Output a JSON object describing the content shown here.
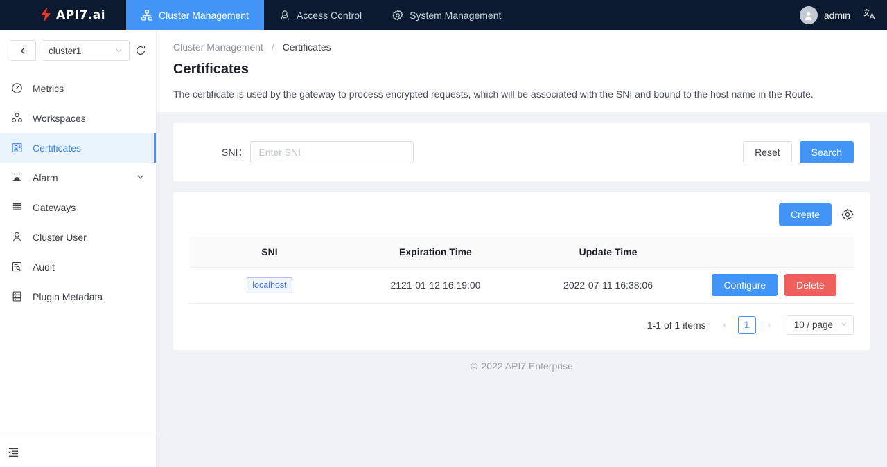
{
  "topnav": {
    "logo_text": "API7.ai",
    "items": [
      {
        "label": "Cluster Management",
        "icon": "cluster-icon",
        "active": true
      },
      {
        "label": "Access Control",
        "icon": "access-control-icon",
        "active": false
      },
      {
        "label": "System Management",
        "icon": "gear-icon",
        "active": false
      }
    ],
    "user": "admin",
    "lang_icon": "文"
  },
  "sidebar": {
    "cluster_value": "cluster1",
    "items": [
      {
        "label": "Metrics",
        "icon": "metrics-icon"
      },
      {
        "label": "Workspaces",
        "icon": "workspaces-icon"
      },
      {
        "label": "Certificates",
        "icon": "certificate-icon"
      },
      {
        "label": "Alarm",
        "icon": "alarm-icon"
      },
      {
        "label": "Gateways",
        "icon": "gateways-icon"
      },
      {
        "label": "Cluster User",
        "icon": "user-icon"
      },
      {
        "label": "Audit",
        "icon": "audit-icon"
      },
      {
        "label": "Plugin Metadata",
        "icon": "plugin-metadata-icon"
      }
    ]
  },
  "breadcrumb": {
    "parent": "Cluster Management",
    "separator": "/",
    "current": "Certificates"
  },
  "page": {
    "title": "Certificates",
    "description": "The certificate is used by the gateway to process encrypted requests, which will be associated with the SNI and bound to the host name in the Route."
  },
  "filter": {
    "label": "SNI：",
    "placeholder": "Enter SNI",
    "value": "",
    "reset_label": "Reset",
    "search_label": "Search"
  },
  "toolbar": {
    "create_label": "Create"
  },
  "table": {
    "columns": [
      "SNI",
      "Expiration Time",
      "Update Time",
      ""
    ],
    "rows": [
      {
        "sni": "localhost",
        "expiration_time": "2121-01-12 16:19:00",
        "update_time": "2022-07-11 16:38:06",
        "configure_label": "Configure",
        "delete_label": "Delete"
      }
    ]
  },
  "pagination": {
    "total_text": "1-1 of 1 items",
    "prev": "‹",
    "current_page": "1",
    "next": "›",
    "page_size": "10 / page"
  },
  "footer": {
    "copyright_symbol": "©",
    "text": "2022 API7 Enterprise"
  },
  "colors": {
    "primary": "#4294f7",
    "danger": "#ef5f5b",
    "topnav_bg": "#0b1a2e",
    "active_menu_bg": "#e9f4fd",
    "tag_text": "#4b6fd8"
  }
}
